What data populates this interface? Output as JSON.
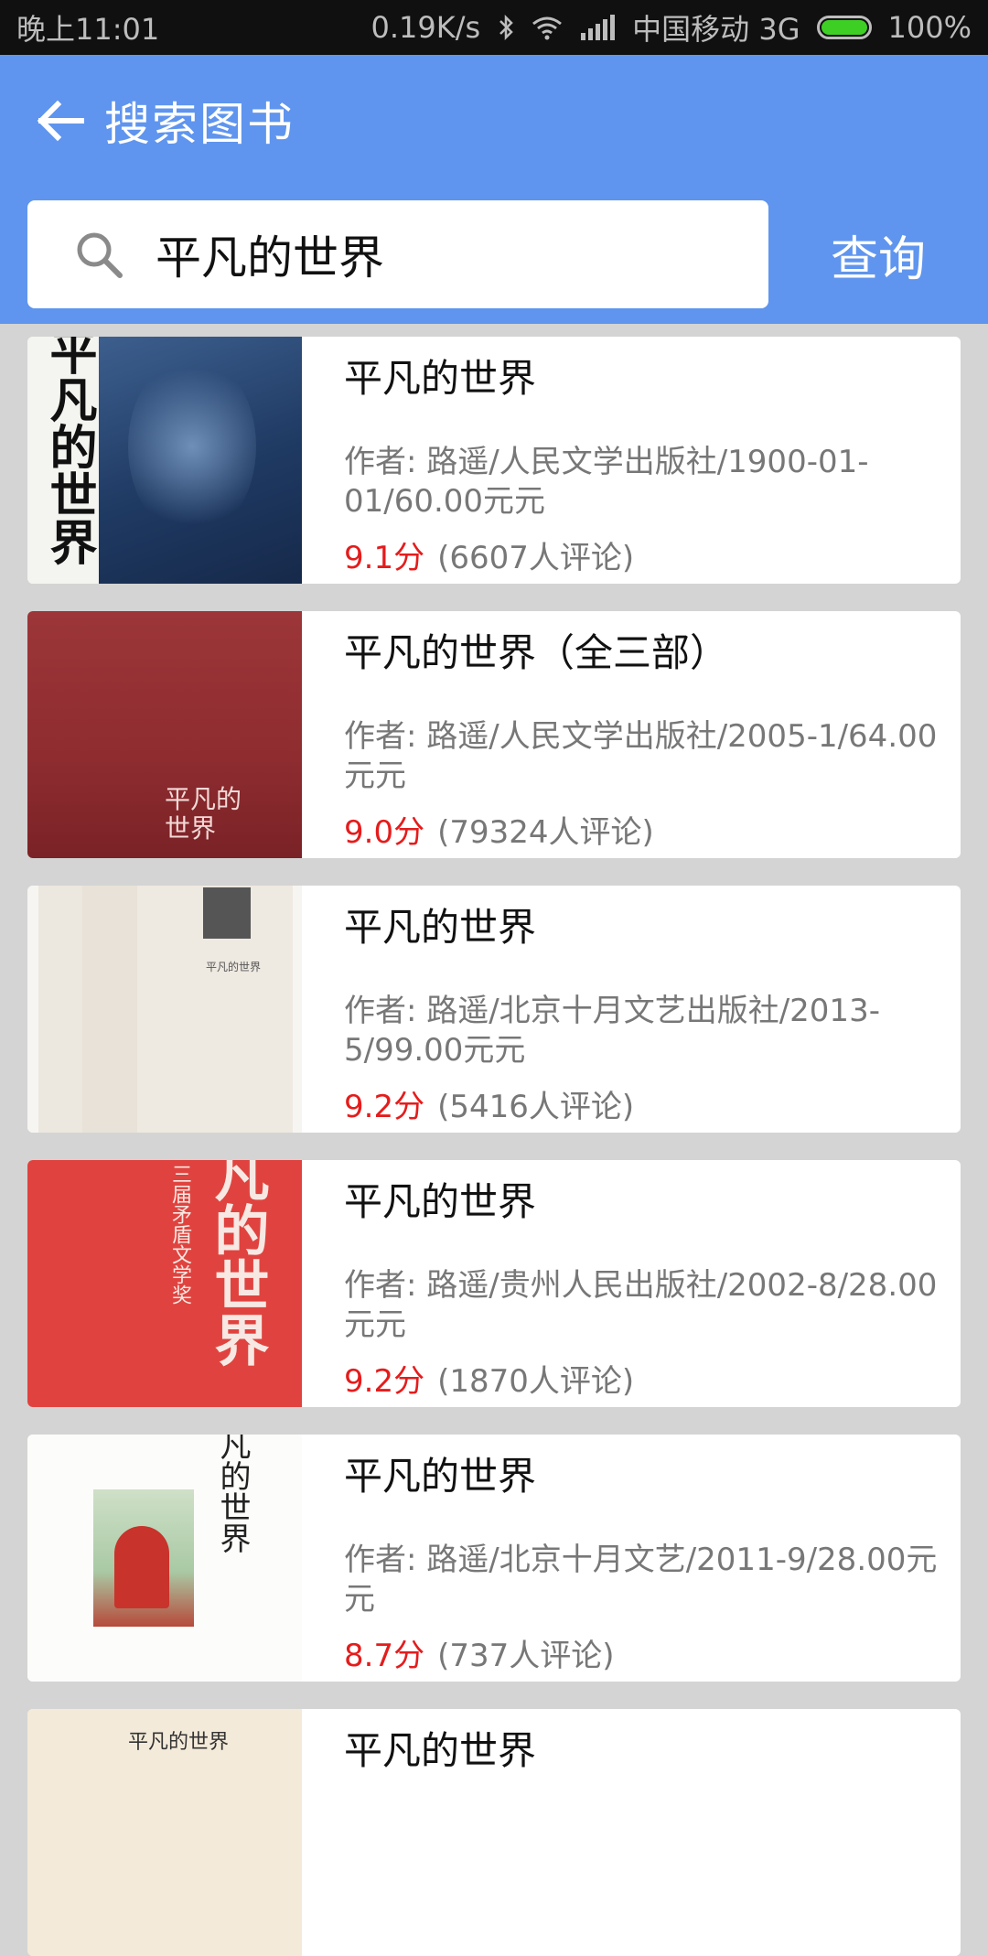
{
  "status_bar": {
    "time": "晚上11:01",
    "speed": "0.19K/s",
    "carrier": "中国移动 3G",
    "battery": "100%"
  },
  "app_bar": {
    "title": "搜索图书"
  },
  "search": {
    "value": "平凡的世界",
    "button_label": "查询"
  },
  "colors": {
    "accent": "#5f95ee",
    "score": "#e51c1c"
  },
  "books": [
    {
      "title": "平凡的世界",
      "author_line": "作者: 路遥/人民文学出版社/1900-01-01/60.00元元",
      "score": "9.1分",
      "reviews": "(6607人评论)"
    },
    {
      "title": "平凡的世界（全三部）",
      "author_line": "作者: 路遥/人民文学出版社/2005-1/64.00元元",
      "score": "9.0分",
      "reviews": "(79324人评论)"
    },
    {
      "title": "平凡的世界",
      "author_line": "作者: 路遥/北京十月文艺出版社/2013-5/99.00元元",
      "score": "9.2分",
      "reviews": "(5416人评论)"
    },
    {
      "title": "平凡的世界",
      "author_line": "作者: 路遥/贵州人民出版社/2002-8/28.00元元",
      "score": "9.2分",
      "reviews": "(1870人评论)"
    },
    {
      "title": "平凡的世界",
      "author_line": "作者: 路遥/北京十月文艺/2011-9/28.00元元",
      "score": "8.7分",
      "reviews": "(737人评论)"
    },
    {
      "title": "平凡的世界",
      "author_line": "",
      "score": "",
      "reviews": ""
    }
  ]
}
